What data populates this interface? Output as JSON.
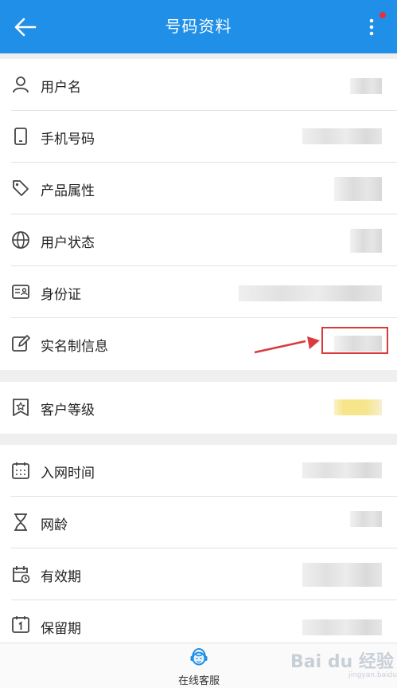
{
  "header": {
    "title": "号码资料",
    "back_icon": "back-arrow-icon",
    "more_icon": "more-vertical-icon",
    "notify_color": "#e8303a",
    "bg_color": "#1f8fe8"
  },
  "rows": [
    {
      "label": "用户名",
      "icon": "user-icon"
    },
    {
      "label": "手机号码",
      "icon": "phone-icon"
    },
    {
      "label": "产品属性",
      "icon": "tag-icon"
    },
    {
      "label": "用户状态",
      "icon": "globe-icon"
    },
    {
      "label": "身份证",
      "icon": "id-card-icon"
    },
    {
      "label": "实名制信息",
      "icon": "edit-icon"
    },
    {
      "label": "客户等级",
      "icon": "star-badge-icon"
    },
    {
      "label": "入网时间",
      "icon": "calendar-icon"
    },
    {
      "label": "网龄",
      "icon": "hourglass-icon"
    },
    {
      "label": "有效期",
      "icon": "calendar-clock-icon"
    },
    {
      "label": "保留期",
      "icon": "calendar-one-icon"
    }
  ],
  "bottom": {
    "service_label": "在线客服",
    "service_icon": "customer-service-icon"
  },
  "watermark": {
    "text": "Bai du 经验",
    "sub": "jingyan.baidu.com"
  },
  "annotation": {
    "arrow_color": "#d93b3b",
    "box_color": "#d93b3b"
  },
  "customer_level_color": "#f6e58a"
}
